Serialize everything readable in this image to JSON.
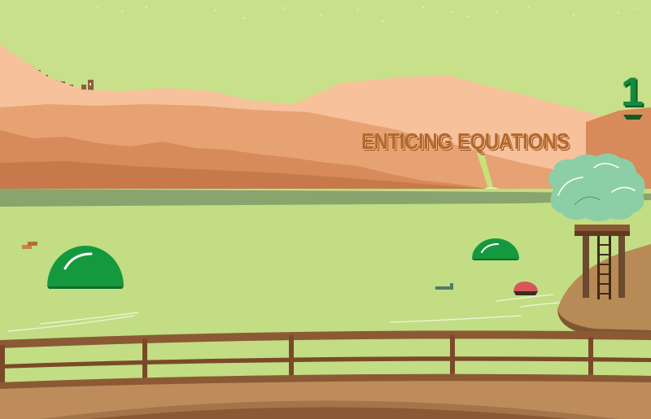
{
  "game": {
    "title": "ENTICING EQUATIONS",
    "level": "1"
  },
  "colors": {
    "sky": "#c9e08a",
    "lake": "#c2dd84",
    "mountain_far": "#f7c19b",
    "mountain_mid": "#e6a272",
    "mountain_near": "#d78a5a",
    "title": "#b5672c",
    "level": "#16893e",
    "bridge": "#8b5a34",
    "dome": "#15993f",
    "treehouse_canopy": "#8ccfa6"
  }
}
